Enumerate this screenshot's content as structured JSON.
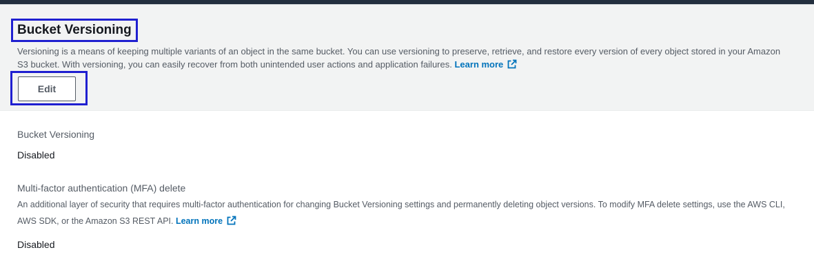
{
  "header": {
    "title": "Bucket Versioning",
    "description": "Versioning is a means of keeping multiple variants of an object in the same bucket. You can use versioning to preserve, retrieve, and restore every version of every object stored in your Amazon S3 bucket. With versioning, you can easily recover from both unintended user actions and application failures.",
    "learn_more": "Learn more",
    "edit_label": "Edit"
  },
  "fields": {
    "versioning": {
      "label": "Bucket Versioning",
      "value": "Disabled"
    },
    "mfa_delete": {
      "label": "Multi-factor authentication (MFA) delete",
      "description": "An additional layer of security that requires multi-factor authentication for changing Bucket Versioning settings and permanently deleting object versions. To modify MFA delete settings, use the AWS CLI, AWS SDK, or the Amazon S3 REST API.",
      "learn_more": "Learn more",
      "value": "Disabled"
    }
  },
  "colors": {
    "link": "#0073bb",
    "highlight_box": "#1f1fd0",
    "header_bg": "#f2f3f3"
  },
  "icons": {
    "external_link": "external-link-icon"
  }
}
